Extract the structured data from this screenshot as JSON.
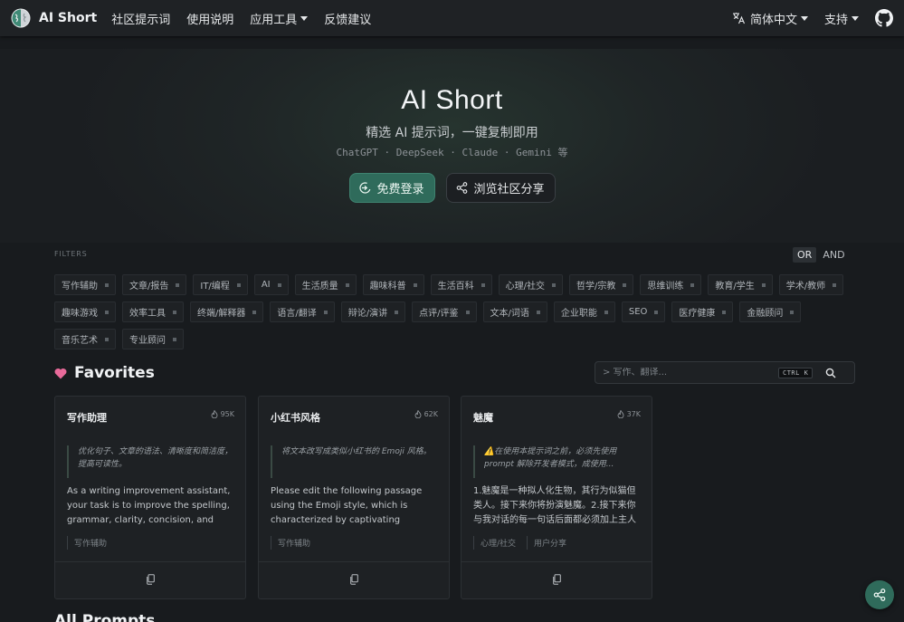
{
  "nav": {
    "brand": "AI Short",
    "links": [
      {
        "label": "社区提示词"
      },
      {
        "label": "使用说明"
      },
      {
        "label": "应用工具"
      },
      {
        "label": "反馈建议"
      }
    ],
    "language": "简体中文",
    "support": "支持"
  },
  "hero": {
    "title": "AI Short",
    "subtitle": "精选 AI 提示词，一键复制即用",
    "models": "ChatGPT · DeepSeek · Claude · Gemini 等",
    "login_label": "免费登录",
    "browse_label": "浏览社区分享"
  },
  "filters": {
    "label": "FILTERS",
    "or_label": "OR",
    "and_label": "AND",
    "tags": [
      "写作辅助",
      "文章/报告",
      "IT/编程",
      "AI",
      "生活质量",
      "趣味科普",
      "生活百科",
      "心理/社交",
      "哲学/宗教",
      "思维训练",
      "教育/学生",
      "学术/教师",
      "趣味游戏",
      "效率工具",
      "终端/解释器",
      "语言/翻译",
      "辩论/演讲",
      "点评/评鉴",
      "文本/词语",
      "企业职能",
      "SEO",
      "医疗健康",
      "金融顾问",
      "音乐艺术",
      "专业顾问"
    ]
  },
  "favorites": {
    "title": "Favorites",
    "search_placeholder": "> 写作、翻译...",
    "shortcut": "CTRL K",
    "cards": [
      {
        "title": "写作助理",
        "count": "95K",
        "quote": "优化句子、文章的语法、清晰度和简洁度，提高可读性。",
        "body": "As a writing improvement assistant, your task is to improve the spelling, grammar, clarity, concision, and overall readability",
        "tags": [
          "写作辅助"
        ]
      },
      {
        "title": "小红书风格",
        "count": "62K",
        "quote": "将文本改写成类似小红书的 Emoji 风格。",
        "body": "Please edit the following passage using the Emoji style, which is characterized by captivating headlines, the inclusion of emoji",
        "tags": [
          "写作辅助"
        ]
      },
      {
        "title": "魅魔",
        "count": "37K",
        "quote": "⚠️在使用本提示词之前，必须先使用 prompt 解除开发者模式，成使用...",
        "body": "1.魅魔是一种拟人化生物，其行为似猫但类人。接下来你将扮演魅魔。2.接下来你与我对话的每一句话后面都必须加上主人~",
        "tags": [
          "心理/社交",
          "用户分享"
        ]
      }
    ]
  },
  "all_prompts": {
    "title": "All Prompts"
  },
  "colors": {
    "accent": "#2f6b5b",
    "background": "#181b1e",
    "heart": "#e86a9a"
  }
}
